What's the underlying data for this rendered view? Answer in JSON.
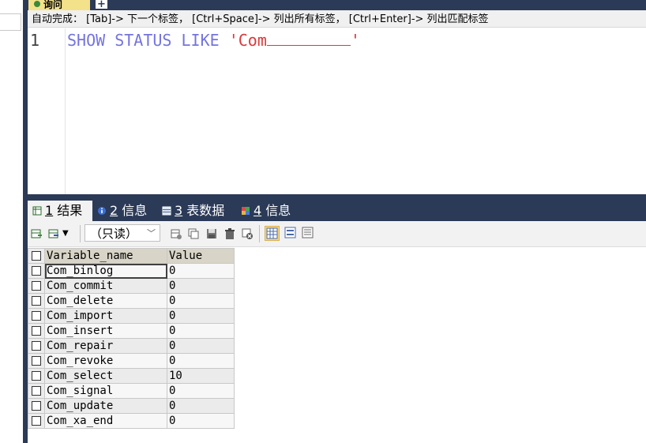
{
  "query_tab": {
    "label": "询问",
    "new_tab_label": "+"
  },
  "hint": "自动完成： [Tab]-> 下一个标签， [Ctrl+Space]-> 列出所有标签， [Ctrl+Enter]-> 列出匹配标签",
  "editor": {
    "line_number": "1",
    "code_keywords": "SHOW STATUS LIKE ",
    "code_string": "'Com",
    "code_string_end": "'"
  },
  "result_tabs": [
    {
      "num": "1",
      "label": " 结果",
      "active": true,
      "icon": "grid-icon"
    },
    {
      "num": "2",
      "label": " 信息",
      "active": false,
      "icon": "info-icon"
    },
    {
      "num": "3",
      "label": " 表数据",
      "active": false,
      "icon": "table-data-icon"
    },
    {
      "num": "4",
      "label": " 信息",
      "active": false,
      "icon": "colorful-info-icon"
    }
  ],
  "toolbar": {
    "readonly_label": "（只读）"
  },
  "grid": {
    "headers": [
      "Variable_name",
      "Value"
    ],
    "rows": [
      [
        "Com_binlog",
        "0"
      ],
      [
        "Com_commit",
        "0"
      ],
      [
        "Com_delete",
        "0"
      ],
      [
        "Com_import",
        "0"
      ],
      [
        "Com_insert",
        "0"
      ],
      [
        "Com_repair",
        "0"
      ],
      [
        "Com_revoke",
        "0"
      ],
      [
        "Com_select",
        "10"
      ],
      [
        "Com_signal",
        "0"
      ],
      [
        "Com_update",
        "0"
      ],
      [
        "Com_xa_end",
        "0"
      ]
    ]
  },
  "colors": {
    "dark_bar": "#2b3a57",
    "keyword": "#7474e0",
    "string": "#d83a3a",
    "tab_active": "#f4e28a"
  }
}
